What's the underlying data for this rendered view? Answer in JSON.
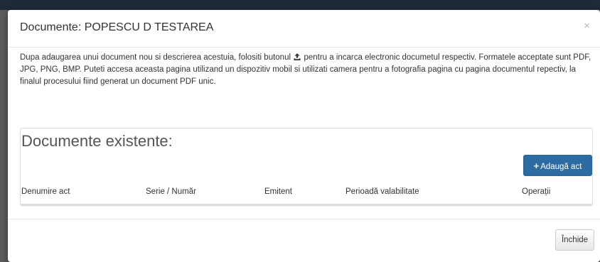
{
  "modal": {
    "title": "Documente: POPESCU D TESTAREA",
    "close_symbol": "×",
    "info_before_icon": "Dupa adaugarea unui document nou si descrierea acestuia, folositi butonul",
    "upload_icon": "upload-icon",
    "info_after_icon": "pentru a incarca electronic documetul respectiv. Formatele acceptate sunt PDF, JPG, PNG, BMP. Puteti accesa aceasta pagina utilizand un dispozitiv mobil si utilizati camera pentru a fotografia pagina cu pagina documentul repectiv, la finalul procesului fiind generat un document PDF unic."
  },
  "panel": {
    "title": "Documente existente:",
    "add_button_icon": "plus-icon",
    "add_button_label": "Adaugă act",
    "columns": [
      "Denumire act",
      "Serie / Număr",
      "Emitent",
      "Perioadă valabilitate",
      "Operații"
    ]
  },
  "footer": {
    "close_button_label": "Închide"
  },
  "colors": {
    "primary": "#2d6ca2",
    "backdrop": "#5c5c5c"
  }
}
